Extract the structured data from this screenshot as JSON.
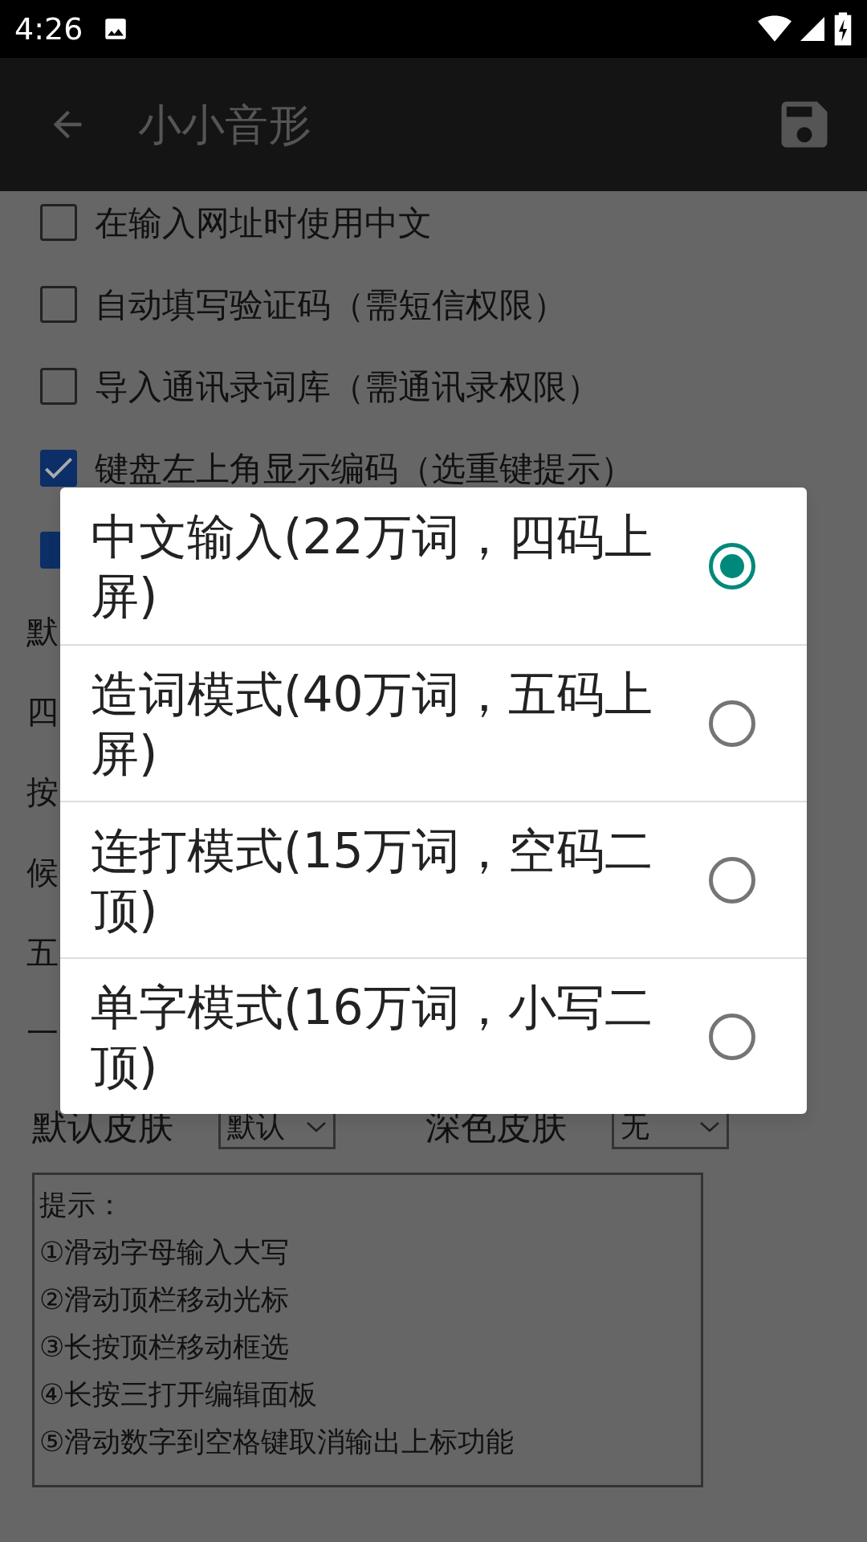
{
  "status_bar": {
    "time": "4:26"
  },
  "toolbar": {
    "title": "小小音形"
  },
  "checkbox_items": [
    {
      "label": "在输入网址时使用中文",
      "checked": false
    },
    {
      "label": "自动填写验证码（需短信权限）",
      "checked": false
    },
    {
      "label": "导入通讯录词库（需通讯录权限）",
      "checked": false
    },
    {
      "label": "键盘左上角显示编码（选重键提示）",
      "checked": true
    },
    {
      "checked": true
    }
  ],
  "hidden_rows": [
    "默",
    "四",
    "按",
    "候",
    "五",
    "一"
  ],
  "skins": [
    {
      "label": "默认皮肤",
      "value": "默认"
    },
    {
      "label": "深色皮肤",
      "value": "无"
    }
  ],
  "tips": {
    "lines": [
      "提示：",
      "①滑动字母输入大写",
      "②滑动顶栏移动光标",
      "③长按顶栏移动框选",
      "④长按三打开编辑面板",
      "⑤滑动数字到空格键取消输出上标功能"
    ]
  },
  "dialog": {
    "options": [
      {
        "label": "中文输入(22万词，四码上屏)",
        "selected": true
      },
      {
        "label": "造词模式(40万词，五码上屏)",
        "selected": false
      },
      {
        "label": "连打模式(15万词，空码二顶)",
        "selected": false
      },
      {
        "label": "单字模式(16万词，小写二顶)",
        "selected": false
      }
    ]
  }
}
